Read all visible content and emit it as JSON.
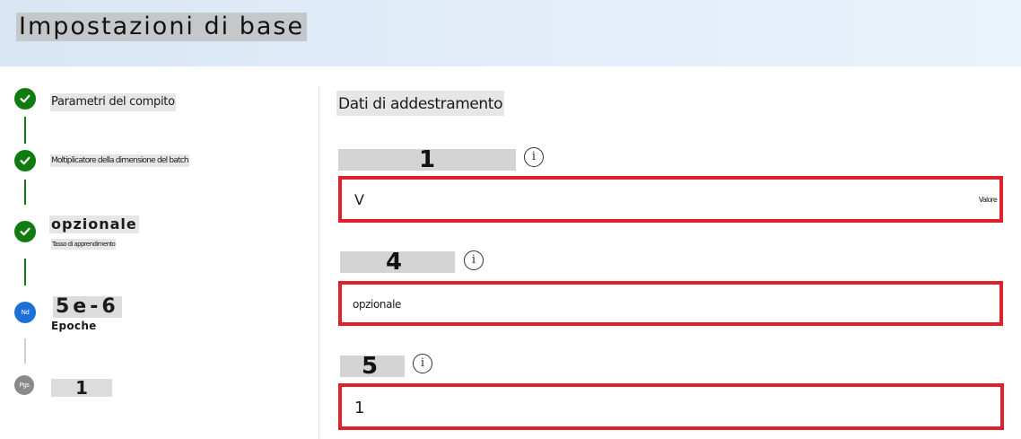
{
  "header": {
    "title": "Impostazioni di base"
  },
  "stepper": {
    "steps": [
      {
        "label": "Parametri del compito",
        "state": "completed",
        "icon": "check-icon"
      },
      {
        "label": "Moltiplicatore della dimensione del batch",
        "state": "completed",
        "icon": "check-icon"
      },
      {
        "label": "opzionale",
        "sublabel": "Tasso di apprendimento",
        "state": "completed",
        "icon": "check-icon"
      },
      {
        "label": "5e-6",
        "sublabel": "Epoche",
        "state": "current",
        "badge": "Nd"
      },
      {
        "label": "1",
        "state": "pending",
        "badge": "Pgs"
      }
    ]
  },
  "main": {
    "section_title": "Dati di addestramento",
    "fields": [
      {
        "label": "1",
        "value": "V",
        "suffix": "Valore"
      },
      {
        "label": "4",
        "value": "opzionale"
      },
      {
        "label": "5",
        "value": "1"
      }
    ]
  },
  "colors": {
    "completed": "#107c10",
    "current": "#1e6fd9",
    "pending": "#8a8a8a",
    "highlight_border": "#e0212c",
    "header_bg": "#dde9f6"
  }
}
